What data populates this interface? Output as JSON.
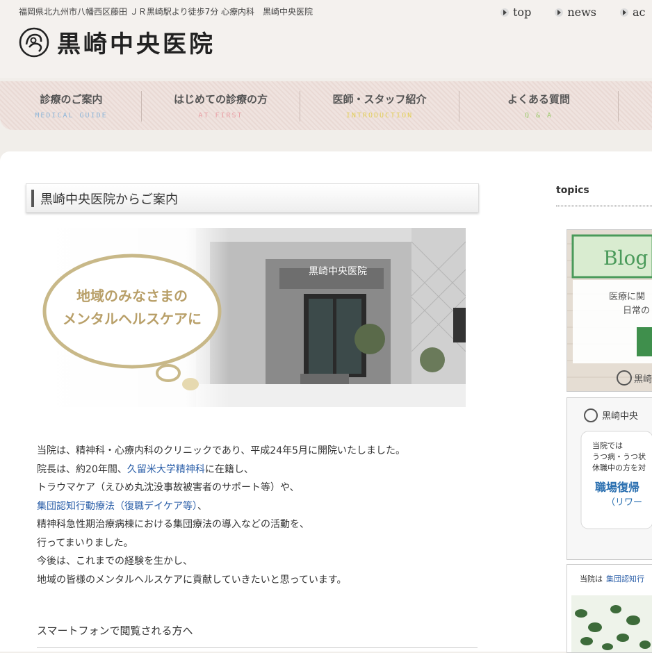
{
  "header": {
    "address": "福岡県北九州市八幡西区藤田 ＪＲ黒崎駅より徒歩7分 心療内科　黒崎中央医院",
    "logo_text": "黒崎中央医院",
    "top_links": [
      "top",
      "news",
      "ac"
    ]
  },
  "nav": {
    "items": [
      {
        "label": "診療のご案内",
        "sub": "MEDICAL GUIDE",
        "sub_color": "#8fb6d8"
      },
      {
        "label": "はじめての診療の方",
        "sub": "AT FIRST",
        "sub_color": "#e9a0a6"
      },
      {
        "label": "医師・スタッフ紹介",
        "sub": "INTRODUCTION",
        "sub_color": "#e3cf5a"
      },
      {
        "label": "よくある質問",
        "sub": "Q & A",
        "sub_color": "#9fcb6f"
      }
    ]
  },
  "main": {
    "section_title": "黒崎中央医院からご案内",
    "hero": {
      "bubble_line1": "地域のみなさまの",
      "bubble_line2": "メンタルヘルスケアに",
      "sign_text": "黒崎中央医院"
    },
    "body": {
      "line1": "当院は、精神科・心療内科のクリニックであり、平成24年5月に開院いたしました。",
      "line2_pre": "院長は、約20年間、",
      "line2_link": "久留米大学精神科",
      "line2_post": "に在籍し、",
      "line3": "トラウマケア（えひめ丸沈没事故被害者のサポート等）や、",
      "line4_link": "集団認知行動療法（復職デイケア等）",
      "line4_post": "、",
      "line5": "精神科急性期治療病棟における集団療法の導入などの活動を、",
      "line6": "行ってまいりました。",
      "line7": "今後は、これまでの経験を生かし、",
      "line8": "地域の皆様のメンタルヘルスケアに貢献していきたいと思っています。"
    },
    "smartphone_text": "スマートフォンで閲覧される方へ"
  },
  "sidebar": {
    "topics_label": "topics",
    "blog_banner": {
      "title": "Blog",
      "line1": "医療に関",
      "line2": "日常の",
      "logo": "黒崎"
    },
    "rework_banner": {
      "logo": "黒崎中央",
      "l1": "当院では",
      "l2": "うつ病・うつ状",
      "l3": "休職中の方を対",
      "big": "職場復帰",
      "sub": "（リワー"
    },
    "group_banner": {
      "pre": "当院は",
      "link": "集団認知行"
    }
  },
  "colors": {
    "link": "#2a5ea8",
    "bubble_border": "#c8b888",
    "bubble_text": "#b89f68",
    "blog_green": "#4a9a5a"
  }
}
